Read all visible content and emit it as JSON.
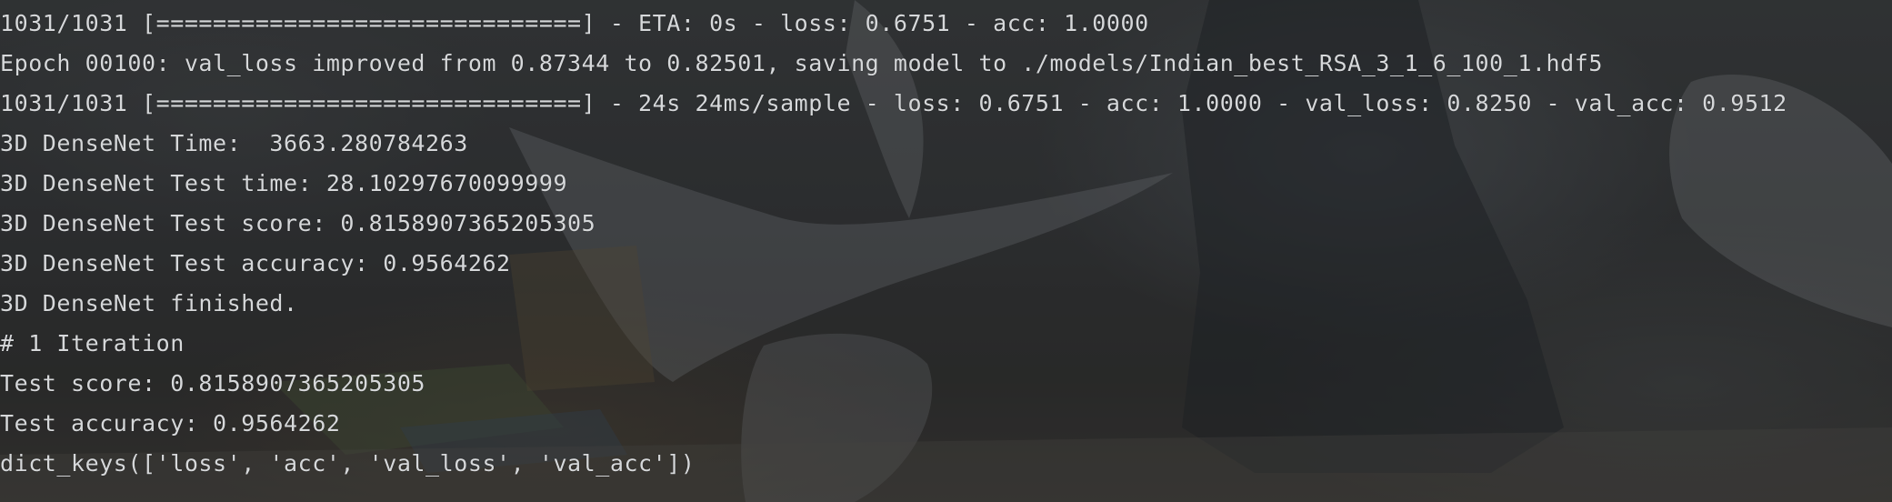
{
  "terminal": {
    "lines": [
      "1031/1031 [==============================] - ETA: 0s - loss: 0.6751 - acc: 1.0000",
      "Epoch 00100: val_loss improved from 0.87344 to 0.82501, saving model to ./models/Indian_best_RSA_3_1_6_100_1.hdf5",
      "1031/1031 [==============================] - 24s 24ms/sample - loss: 0.6751 - acc: 1.0000 - val_loss: 0.8250 - val_acc: 0.9512",
      "3D DenseNet Time:  3663.280784263",
      "3D DenseNet Test time: 28.10297670099999",
      "3D DenseNet Test score: 0.8158907365205305",
      "3D DenseNet Test accuracy: 0.9564262",
      "3D DenseNet finished.",
      "# 1 Iteration",
      "Test score: 0.8158907365205305",
      "Test accuracy: 0.9564262",
      "dict_keys(['loss', 'acc', 'val_loss', 'val_acc'])"
    ]
  }
}
